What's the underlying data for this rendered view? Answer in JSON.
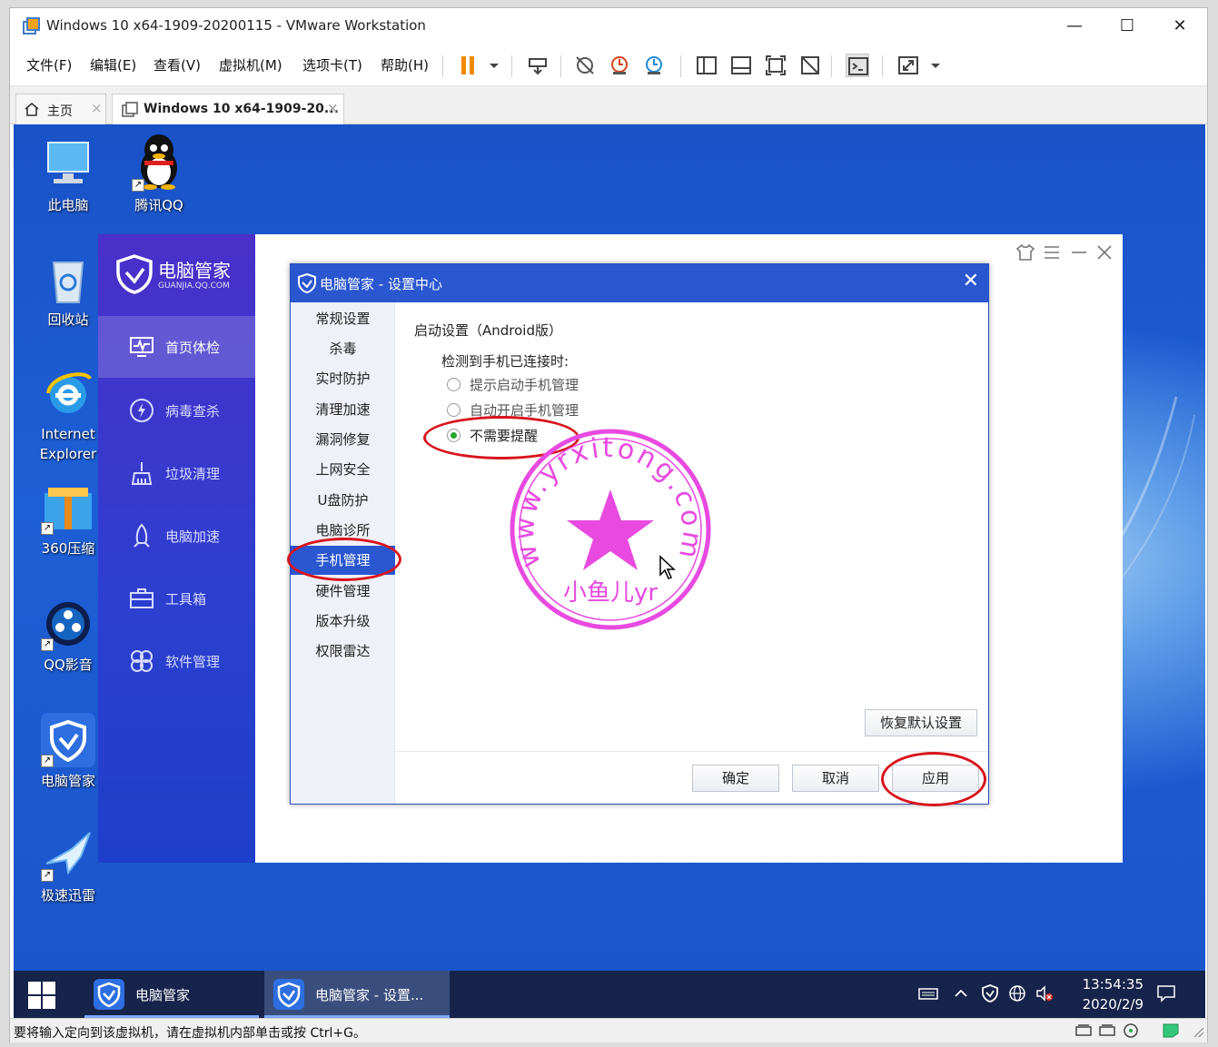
{
  "window": {
    "title": "Windows 10 x64-1909-20200115 - VMware Workstation",
    "min": "—",
    "max": "☐",
    "close": "✕"
  },
  "menu": [
    "文件(F)",
    "编辑(E)",
    "查看(V)",
    "虚拟机(M)",
    "选项卡(T)",
    "帮助(H)"
  ],
  "tabs": [
    {
      "label": "主页",
      "close": "×"
    },
    {
      "label": "Windows 10 x64-1909-20...",
      "close": "×"
    }
  ],
  "desktop": {
    "icons": [
      "此电脑",
      "腾讯QQ",
      "回收站",
      "Internet Explorer",
      "360压缩",
      "QQ影音",
      "电脑管家",
      "极速迅雷"
    ]
  },
  "pcmanager": {
    "logo_name": "电脑管家",
    "logo_sub": "GUANJIA.QQ.COM",
    "nav": [
      "首页体检",
      "病毒查杀",
      "垃圾清理",
      "电脑加速",
      "工具箱",
      "软件管理"
    ],
    "active_nav": 0
  },
  "dialog": {
    "title": "电脑管家 - 设置中心",
    "close": "✕",
    "nav": [
      "常规设置",
      "杀毒",
      "实时防护",
      "清理加速",
      "漏洞修复",
      "上网安全",
      "U盘防护",
      "电脑诊所",
      "手机管理",
      "硬件管理",
      "版本升级",
      "权限雷达"
    ],
    "active_nav": "手机管理",
    "section_title": "启动设置（Android版）",
    "sub_title": "检测到手机已连接时:",
    "options": [
      "提示启动手机管理",
      "自动开启手机管理",
      "不需要提醒"
    ],
    "selected_option": "不需要提醒",
    "restore_button": "恢复默认设置",
    "ok_button": "确定",
    "cancel_button": "取消",
    "apply_button": "应用"
  },
  "watermark": {
    "text": "www.yrxitong.com",
    "bottom": "小鱼儿yr",
    "color": "#e84ae0"
  },
  "taskbar": {
    "tasks": [
      "电脑管家",
      "电脑管家 - 设置..."
    ],
    "time": "13:54:35",
    "date": "2020/2/9"
  },
  "statusbar": {
    "message": "要将输入定向到该虚拟机，请在虚拟机内部单击或按 Ctrl+G。"
  },
  "colors": {
    "accent": "#2a56d0",
    "highlight": "#d8141c",
    "radio_on": "#27a42f"
  }
}
